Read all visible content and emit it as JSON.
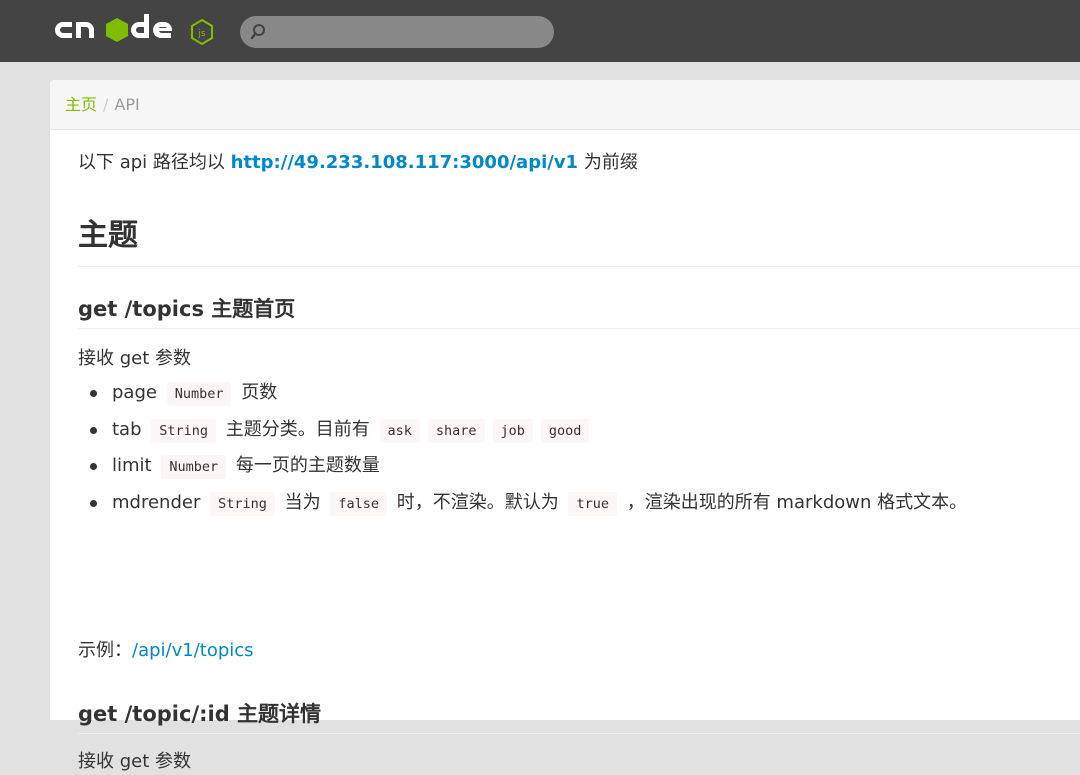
{
  "search": {
    "placeholder": ""
  },
  "breadcrumb": {
    "home": "主页",
    "separator": "/",
    "current": "API"
  },
  "intro": {
    "prefix": "以下 api 路径均以",
    "base_url": "http://49.233.108.117:3000/api/v1",
    "suffix": "为前缀"
  },
  "section": {
    "title": "主题"
  },
  "endpoints": [
    {
      "title": "get /topics 主题首页",
      "accepts": "接收 get 参数",
      "params": [
        {
          "name": "page",
          "type": "Number",
          "desc": "页数"
        },
        {
          "name": "tab",
          "type": "String",
          "desc": "主题分类。目前有",
          "options": [
            "ask",
            "share",
            "job",
            "good"
          ]
        },
        {
          "name": "limit",
          "type": "Number",
          "desc": "每一页的主题数量"
        },
        {
          "name": "mdrender",
          "type": "String",
          "desc_a": "当为",
          "code_a": "false",
          "desc_b": "时，不渲染。默认为",
          "code_b": "true",
          "desc_c": "，渲染出现的所有 markdown 格式文本。"
        }
      ],
      "example_label": "示例：",
      "example_link": "/api/v1/topics"
    },
    {
      "title": "get /topic/:id 主题详情",
      "accepts": "接收 get 参数"
    }
  ],
  "colors": {
    "navbar": "#444444",
    "brand_green": "#80bd01",
    "link": "#0088cc"
  }
}
